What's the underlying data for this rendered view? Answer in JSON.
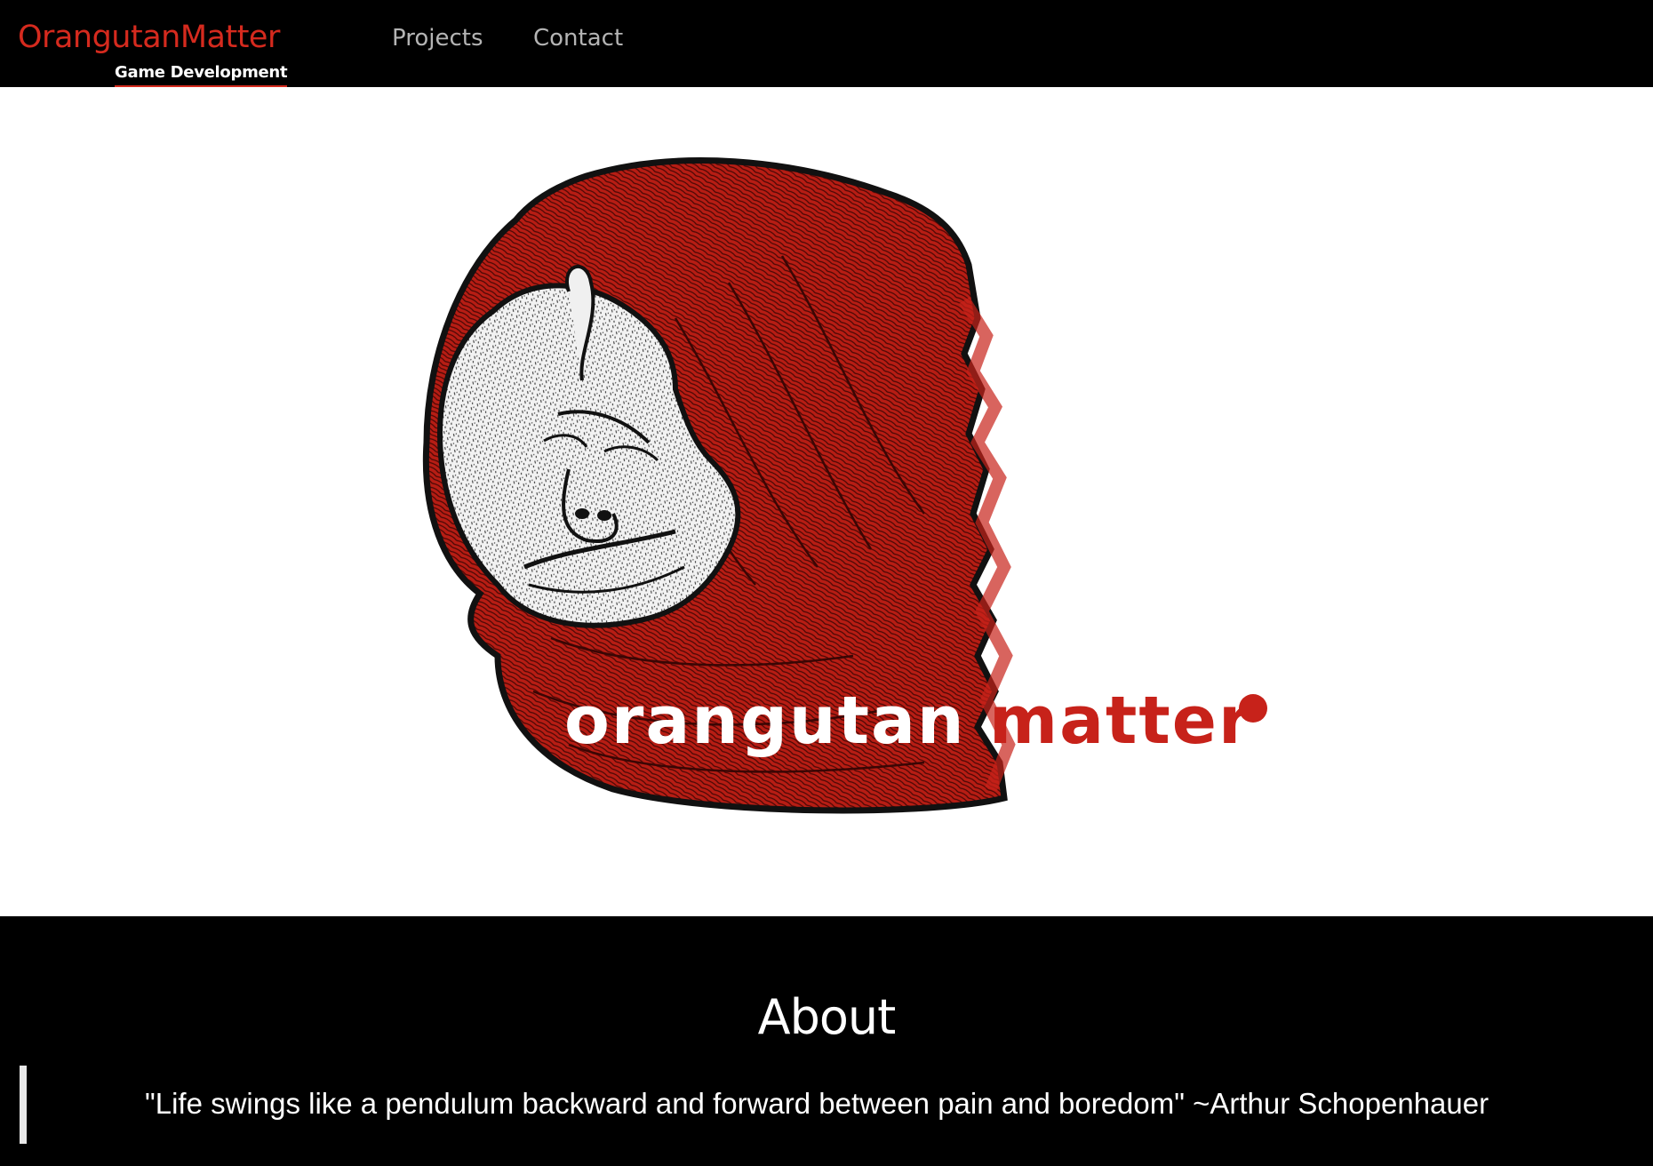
{
  "brand": {
    "title": "OrangutanMatter",
    "subtitle": "Game Development",
    "accent_color": "#d52a1e"
  },
  "nav": {
    "items": [
      {
        "label": "Projects"
      },
      {
        "label": "Contact"
      }
    ]
  },
  "hero": {
    "logo_word_1": "orangutan",
    "logo_word_2": "matter",
    "logo_icon": "orangutan-face-illustration"
  },
  "about": {
    "title": "About",
    "quote": "\"Life swings like a pendulum backward and forward between pain and boredom\" ~Arthur Schopenhauer"
  }
}
